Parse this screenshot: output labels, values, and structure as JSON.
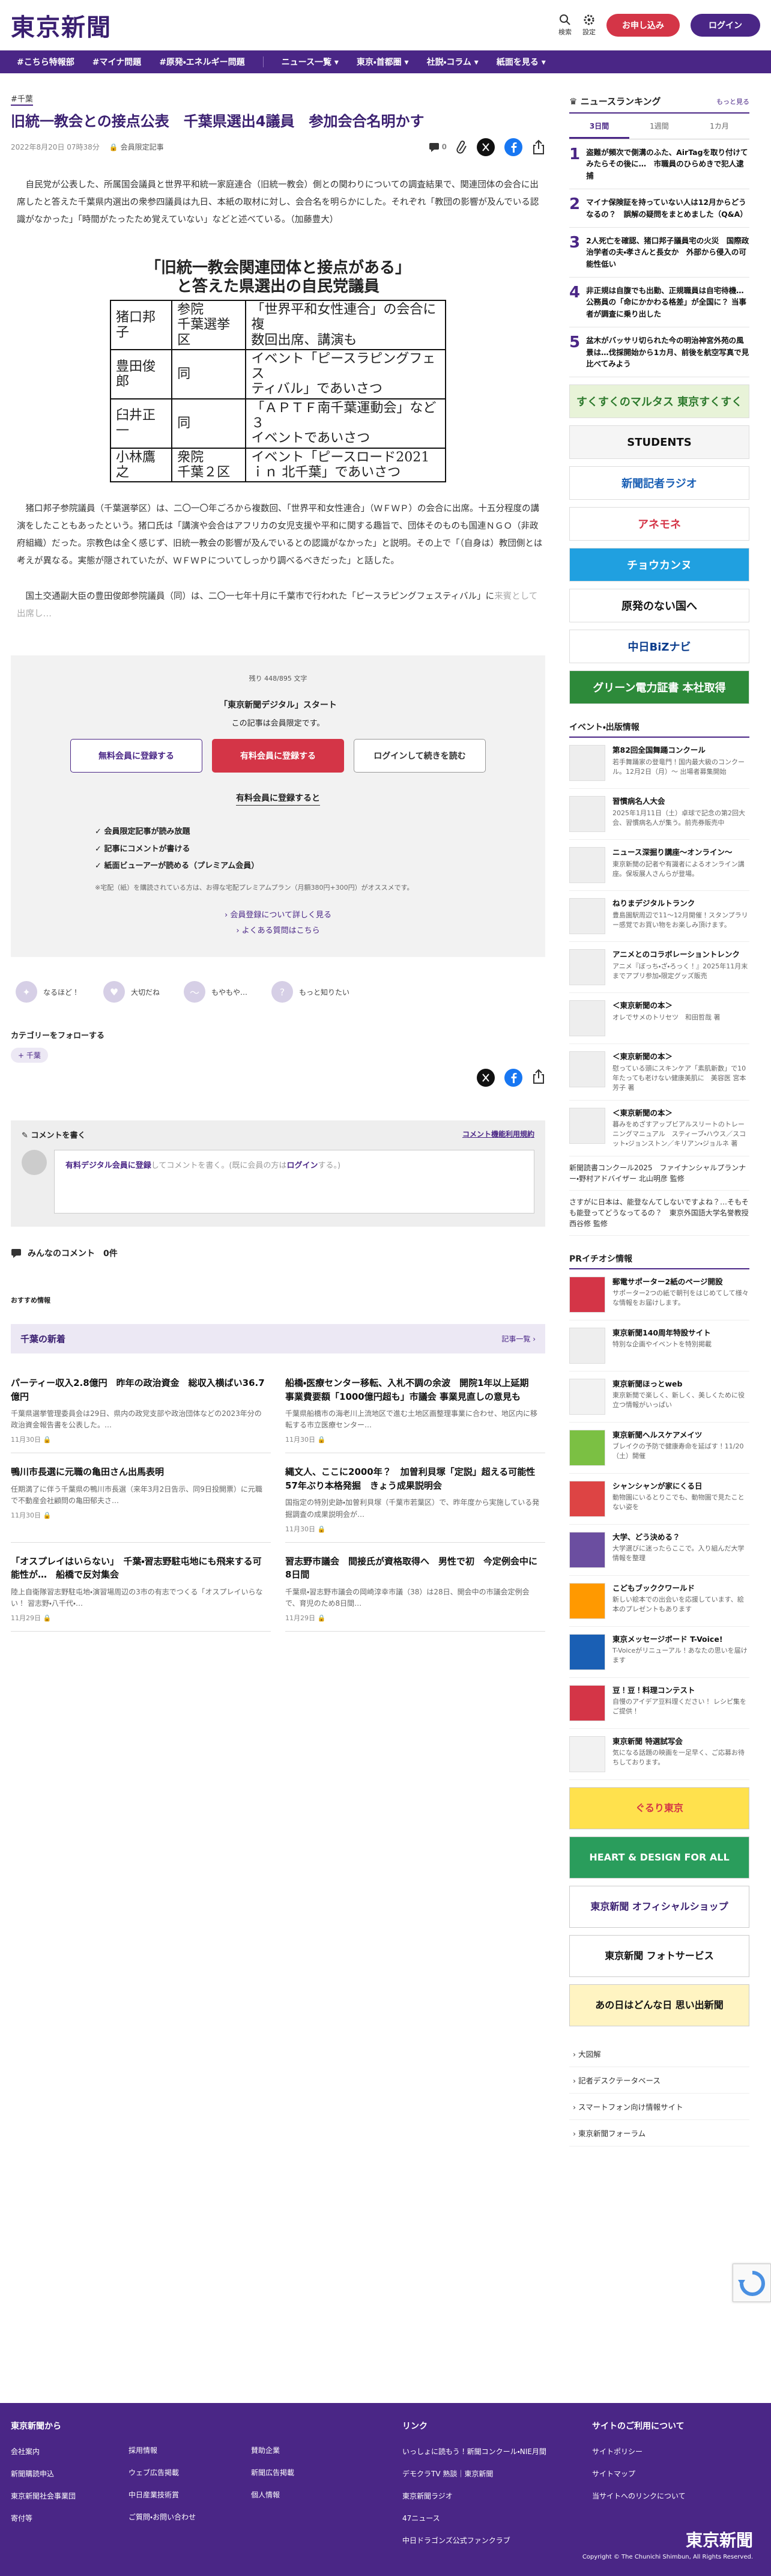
{
  "header": {
    "logo": "東京新聞",
    "search_label": "検索",
    "settings_label": "設定",
    "subscribe": "お申し込み",
    "login": "ログイン"
  },
  "nav": [
    "#こちら特報部",
    "#マイナ問題",
    "#原発・エネルギー問題",
    "ニュース一覧",
    "東京・首都圏",
    "社説・コラム",
    "紙面を見る"
  ],
  "article": {
    "category": "#千葉",
    "title": "旧統一教会との接点公表　千葉県選出4議員　参加会合名明かす",
    "date": "2022年8月20日 07時38分",
    "badge": "会員限定記事",
    "comment_count": "0",
    "para1": "自民党が公表した、所属国会議員と世界平和統一家庭連合（旧統一教会）側との関わりについての調査結果で、関連団体の会合に出席したと答えた千葉県内選出の衆参四議員は九日、本紙の取材に対し、会合名を明らかにした。それぞれ「教団の影響が及んでいる認識がなかった」「時間がたったため覚えていない」などと述べている。（加藤豊大）",
    "figure": {
      "title1": "「旧統一教会関連団体と接点がある」",
      "title2": "と答えた県選出の自民党議員",
      "rows": [
        {
          "name": "猪口邦子",
          "district": "参院\n千葉選挙区",
          "detail": "「世界平和女性連合」の会合に複\n数回出席、講演も"
        },
        {
          "name": "豊田俊郎",
          "district": "同",
          "detail": "イベント「ピースラピングフェス\nティバル」であいさつ"
        },
        {
          "name": "臼井正一",
          "district": "同",
          "detail": "「ＡＰＴＦ南千葉運動会」など３\nイベントであいさつ"
        },
        {
          "name": "小林鷹之",
          "district": "衆院\n千葉２区",
          "detail": "イベント「ピースロード2021\nｉｎ 北千葉」であいさつ"
        }
      ]
    },
    "para2": "猪口邦子参院議員（千葉選挙区）は、二〇一〇年ごろから複数回、「世界平和女性連合」（ＷＦＷＰ）の会合に出席。十五分程度の講演をしたこともあったという。猪口氏は「講演や会合はアフリカの女児支援や平和に関する趣旨で、団体そのものも国連ＮＧＯ（非政府組織）だった。宗教色は全く感じず、旧統一教会の影響が及んでいるとの認識がなかった」と説明。その上で「（自身は）教団側とは考えが異なる。実態が隠されていたが、ＷＦＷＰについてしっかり調べるべきだった」と話した。",
    "para3_a": "国土交通副大臣の豊田俊郎参院議員（同）は、二〇一七年十月に千葉市で行われた「ピースラピングフェスティバル」に",
    "para3_b": "来賓として出席し…"
  },
  "paywall": {
    "remaining": "残り 448/895 文字",
    "title": "「東京新聞デジタル」スタート",
    "subtitle": "この記事は会員限定です。",
    "btn_free": "無料会員に登録する",
    "btn_paid": "有料会員に登録する",
    "btn_login": "ログインして続きを読む",
    "reg_heading": "有料会員に登録すると",
    "benefits": [
      "会員限定記事が読み放題",
      "記事にコメントが書ける",
      "紙面ビューアーが読める（プレミアム会員）"
    ],
    "note": "※宅配（紙）を購読されている方は、お得な宅配プレミアムプラン（月額380円+300円）がオススメです。",
    "link1": "会員登録について詳しく見る",
    "link2": "よくある質問はこちら"
  },
  "reactions": [
    "なるほど！",
    "大切だね",
    "もやもや…",
    "もっと知りたい"
  ],
  "follow": {
    "heading": "カテゴリーをフォローする",
    "tag": "+ 千葉"
  },
  "comments": {
    "box_title": "コメントを書く",
    "rules": "コメント機能利用規約",
    "prompt_a": "有料デジタル会員に登録",
    "prompt_b": "してコメントを書く。(既に会員の方は",
    "prompt_c": "ログイン",
    "prompt_d": "する。)",
    "count_label": "みんなのコメント　0件"
  },
  "recommend_label": "おすすめ情報",
  "chiba": {
    "heading": "千葉の新着",
    "more": "記事一覧",
    "cards": [
      {
        "title": "パーティー収入2.8億円　昨年の政治資金　総収入横ばい36.7億円",
        "body": "千葉県選挙管理委員会は29日、県内の政党支部や政治団体などの2023年分の政治資金報告書を公表した。…",
        "date": "11月30日"
      },
      {
        "title": "船橋・医療センター移転、入札不調の余波　開院1年以上延期　事業費要額「1000億円超も」市議会 事業見直しの意見も",
        "body": "千葉県船橋市の海老川上流地区で進む土地区画整理事業に合わせ、地区内に移転する市立医療センター…",
        "date": "11月30日"
      },
      {
        "title": "鴨川市長選に元職の亀田さん出馬表明",
        "body": "任期満了に伴う千葉県の鴨川市長選（来年3月2日告示、同9日投開票）に元職で不動産会社顧問の亀田郁夫さ…",
        "date": "11月30日"
      },
      {
        "title": "縄文人、ここに2000年？　加曽利貝塚「定説」超える可能性　57年ぶり本格発掘　きょう成果説明会",
        "body": "国指定の特別史跡・加曽利貝塚（千葉市若葉区）で、昨年度から実施している発掘調査の成果説明会が…",
        "date": "11月30日"
      },
      {
        "title": "「オスプレイはいらない」　千葉・習志野駐屯地にも飛来する可能性が…　船橋で反対集会",
        "body": "陸上自衛隊習志野駐屯地・演習場周辺の3市の有志でつくる「オスプレイいらない！ 習志野・八千代・…",
        "date": "11月29日"
      },
      {
        "title": "習志野市議会　間接氏が資格取得へ　男性で初　今定例会中に8日間",
        "body": "千葉県・習志野市議会の岡崎淳幸市議（38）は28日、開会中の市議会定例会で、育児のため8日間…",
        "date": "11月29日"
      }
    ]
  },
  "ranking": {
    "heading": "ニュースランキング",
    "more": "もっと見る",
    "tabs": [
      "3日間",
      "1週間",
      "1カ月"
    ],
    "items": [
      "盗難が頻次で側溝のふた、AirTagを取り付けてみたらその後に…　市職員のひらめきで犯人逮捕",
      "マイナ保険証を持っていない人は12月からどうなるの？　誤解の疑問をまとめました（Q&A）",
      "2人死亡を確認、猪口邦子議員宅の火災　国際政治学者の夫・孝さんと長女か　外部から侵入の可能性低い",
      "非正規は自腹でも出勤、正規職員は自宅待機…公務員の「命にかかわる格差」が全国に？ 当事者が調査に乗り出した",
      "盆木がバッサリ切られた今の明治神宮外苑の風景は…伐採開始から1カ月、前後を航空写真で見比べてみよう"
    ]
  },
  "ads": [
    "すくすくのマルタス 東京すくすく",
    "STUDENTS",
    "新聞記者ラジオ",
    "アネモネ",
    "チョウカンヌ",
    "原発のない国へ",
    "中日BiZナビ",
    "グリーン電力証書 本社取得"
  ],
  "events": {
    "heading": "イベント・出版情報",
    "items": [
      {
        "t": "第82回全国舞踊コンクール",
        "s": "若手舞踊家の登竜門！国内最大級のコンクール。12月2日（月）〜 出場者募集開始"
      },
      {
        "t": "習慣病名人大会",
        "s": "2025年1月11日（土）卓球で記念の第2回大会、習慣病名人が集う。前売券販売中"
      },
      {
        "t": "ニュース深掘り講座〜オンライン〜",
        "s": "東京新聞の記者や有識者によるオンライン講座。保坂展人さんらが登場。"
      },
      {
        "t": "ねりまデジタルトランク",
        "s": "豊島園駅周辺で11〜12月開催！スタンプラリー感覚でお買い物をお楽しみ頂けます。"
      },
      {
        "t": "アニメとのコラボレーショントレンク",
        "s": "アニメ『ぼっち・ざ・ろっく！』2025年11月末までアプリ参加・限定グッズ販売"
      },
      {
        "t": "＜東京新聞の本＞",
        "s": "オレでサメのトリセツ　和田哲哉 著"
      },
      {
        "t": "＜東京新聞の本＞",
        "s": "慰っている頭にスキンケア「素肌新数」で10年たっても老けない健康美肌に　美容医 宮本芳子 著"
      },
      {
        "t": "＜東京新聞の本＞",
        "s": "暮みをめざすアップビアルスリートのトレーニングマニュアル　スティーブ・ハウス／スコット・ジョンストン／キリアン・ジョルネ 著"
      }
    ],
    "text_links": [
      "新聞読書コンクール2025　ファイナンシャルプランナー・野村アドバイザー 北山明彦 監修",
      "さすがに日本は、能登なんてしないですよね？…そもそも能登ってどうなってるの？　東京外国語大学名誉教授 西谷修 監修"
    ]
  },
  "pr": {
    "heading": "PRイチオシ情報",
    "items": [
      {
        "t": "郵電サポーター2紙のページ開設",
        "s": "サポーター2つの紙で朝刊をはじめてして様々な情報をお届けします。"
      },
      {
        "t": "東京新聞140周年特設サイト",
        "s": "特別な企画やイベントを特別掲載"
      },
      {
        "t": "東京新聞ほっとweb",
        "s": "東京新聞で楽しく、新しく、美しくために役立つ情報がいっぱい"
      },
      {
        "t": "東京新聞ヘルスケアメイツ",
        "s": "ブレイクの予防で健康寿命を延ばす！11/20（土）開催"
      },
      {
        "t": "シャンシャンが家にくる日",
        "s": "動物園にいるとりこでも、動物園で見たことない姿を"
      },
      {
        "t": "大学、どう決める？",
        "s": "大学選びに迷ったらここで。入り組んだ大学情報を整理"
      },
      {
        "t": "こどもブッククワールド",
        "s": "新しい絵本での出会いを応援しています、絵本のプレゼントもあります"
      },
      {
        "t": "東京メッセージボード T-Voice!",
        "s": "T-Voiceがリニューアル！あなたの思いを届けます"
      },
      {
        "t": "豆！豆！料理コンテスト",
        "s": "自慢のアイデア豆料理ください！ レシピ集をご提供！"
      },
      {
        "t": "東京新聞 特選試写会",
        "s": "気になる話題の映画を一足早く、ご応募お待ちしております。"
      }
    ]
  },
  "banners": [
    "ぐるり東京",
    "HEART & DESIGN FOR ALL",
    "東京新聞 オフィシャルショップ",
    "東京新聞 フォトサービス",
    "あの日はどんな日 思い出新聞"
  ],
  "side_links": [
    "大図解",
    "記者デスクテータベース",
    "スマートフォン向け情報サイト",
    "東京新聞フォーラム"
  ],
  "footer": {
    "col1_title": "東京新聞から",
    "col1": [
      "会社案内",
      "新聞購読申込",
      "東京新聞社会事業団",
      "寄付等"
    ],
    "col2": [
      "採用情報",
      "ウェブ広告掲載",
      "中日産業技術賞",
      "ご質問・お問い合わせ"
    ],
    "col3": [
      "賛助企業",
      "新聞広告掲載",
      "個人情報"
    ],
    "col4_title": "リンク",
    "col4": [
      "いっしょに読もう！新聞コンクール・NIE月間",
      "デモクラTV 熟談｜東京新聞",
      "東京新聞ラジオ",
      "47ニュース",
      "中日ドラゴンズ公式ファンクラブ"
    ],
    "col5_title": "サイトのご利用について",
    "col5": [
      "サイトポリシー",
      "サイトマップ",
      "当サイトへのリンクについて"
    ],
    "logo": "東京新聞",
    "copyright": "Copyright © The Chunichi Shimbun, All Rights Reserved."
  },
  "colors": {
    "brand": "#4a2686",
    "accent": "#d43547"
  }
}
